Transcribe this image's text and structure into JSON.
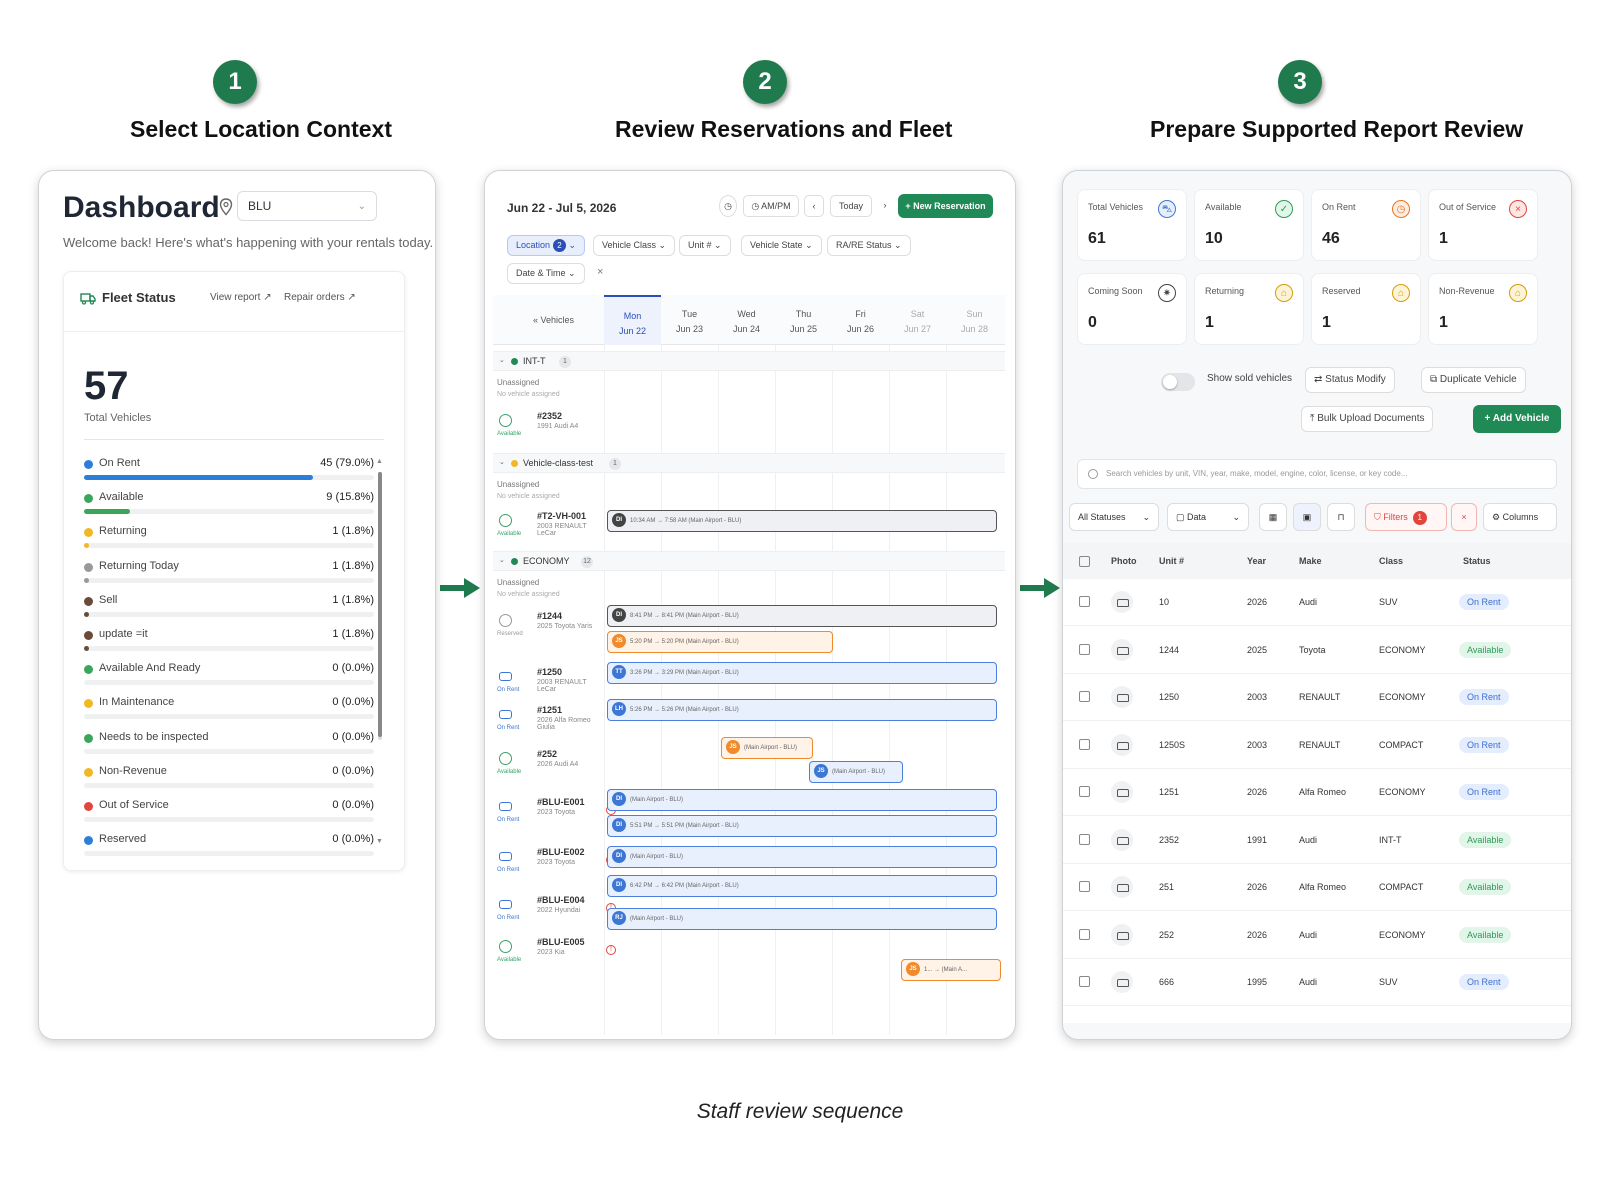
{
  "steps": [
    {
      "number": "1",
      "title": "Select Location Context"
    },
    {
      "number": "2",
      "title": "Review Reservations and Fleet"
    },
    {
      "number": "3",
      "title": "Prepare Supported Report Review"
    }
  ],
  "caption": "Staff review sequence",
  "panel1": {
    "title": "Dashboard",
    "location": "BLU",
    "welcome": "Welcome back! Here's what's happening with your rentals today.",
    "fleet_title": "Fleet Status",
    "view_report": "View report",
    "repair_orders": "Repair orders",
    "total": "57",
    "total_label": "Total Vehicles",
    "statuses": [
      {
        "name": "On Rent",
        "value": "45 (79.0%)",
        "color": "#2b7fd8",
        "fill": 0.79
      },
      {
        "name": "Available",
        "value": "9 (15.8%)",
        "color": "#3aa65a",
        "fill": 0.158
      },
      {
        "name": "Returning",
        "value": "1 (1.8%)",
        "color": "#f2b824",
        "fill": 0.018
      },
      {
        "name": "Returning Today",
        "value": "1 (1.8%)",
        "color": "#999999",
        "fill": 0.018
      },
      {
        "name": "Sell",
        "value": "1 (1.8%)",
        "color": "#6b4a3a",
        "fill": 0.018
      },
      {
        "name": "update =it",
        "value": "1 (1.8%)",
        "color": "#6b4a3a",
        "fill": 0.018
      },
      {
        "name": "Available And Ready",
        "value": "0 (0.0%)",
        "color": "#3aa65a",
        "fill": 0
      },
      {
        "name": "In Maintenance",
        "value": "0 (0.0%)",
        "color": "#f2b824",
        "fill": 0
      },
      {
        "name": "Needs to be inspected",
        "value": "0 (0.0%)",
        "color": "#3aa65a",
        "fill": 0
      },
      {
        "name": "Non-Revenue",
        "value": "0 (0.0%)",
        "color": "#f2b824",
        "fill": 0
      },
      {
        "name": "Out of Service",
        "value": "0 (0.0%)",
        "color": "#e0463b",
        "fill": 0
      },
      {
        "name": "Reserved",
        "value": "0 (0.0%)",
        "color": "#2b7fd8",
        "fill": 0
      }
    ]
  },
  "panel2": {
    "date_range": "Jun 22 - Jul 5, 2026",
    "ampm": "AM/PM",
    "today": "Today",
    "new_reservation": "New Reservation",
    "filters": {
      "location": "Location",
      "location_count": "2",
      "vehicle_class": "Vehicle Class",
      "unit": "Unit #",
      "vehicle_state": "Vehicle State",
      "rare_status": "RA/RE Status",
      "date_time": "Date & Time"
    },
    "vehicles_label": "« Vehicles",
    "days": [
      {
        "dow": "Mon",
        "date": "Jun 22"
      },
      {
        "dow": "Tue",
        "date": "Jun 23"
      },
      {
        "dow": "Wed",
        "date": "Jun 24"
      },
      {
        "dow": "Thu",
        "date": "Jun 25"
      },
      {
        "dow": "Fri",
        "date": "Jun 26"
      },
      {
        "dow": "Sat",
        "date": "Jun 27"
      },
      {
        "dow": "Sun",
        "date": "Jun 28"
      }
    ],
    "groups": [
      {
        "name": "INT-T",
        "count": "1"
      },
      {
        "name": "Vehicle-class-test",
        "count": "1"
      },
      {
        "name": "ECONOMY",
        "count": "12"
      }
    ],
    "unassigned": "Unassigned",
    "no_vehicle": "No vehicle assigned",
    "vehicles": [
      {
        "unit": "#2352",
        "desc": "1991 Audi A4",
        "status": "Available"
      },
      {
        "unit": "#T2-VH-001",
        "desc": "2003 RENAULT LeCar",
        "status": "Available"
      },
      {
        "unit": "#1244",
        "desc": "2025 Toyota Yaris",
        "status": "Reserved"
      },
      {
        "unit": "#1250",
        "desc": "2003 RENAULT LeCar",
        "status": "On Rent"
      },
      {
        "unit": "#1251",
        "desc": "2026 Alfa Romeo Giulia",
        "status": "On Rent"
      },
      {
        "unit": "#252",
        "desc": "2026 Audi A4",
        "status": "Available"
      },
      {
        "unit": "#BLU-E001",
        "desc": "2023 Toyota",
        "status": "On Rent"
      },
      {
        "unit": "#BLU-E002",
        "desc": "2023 Toyota",
        "status": "On Rent"
      },
      {
        "unit": "#BLU-E004",
        "desc": "2022 Hyundai",
        "status": "On Rent"
      },
      {
        "unit": "#BLU-E005",
        "desc": "2023 Kia",
        "status": "Available"
      }
    ],
    "bars": [
      {
        "initials": "DI",
        "text": "10:34 AM → 7:58 AM (Main Airport - BLU)"
      },
      {
        "initials": "DI",
        "text": "8:41 PM → 8:41 PM (Main Airport - BLU)"
      },
      {
        "initials": "JS",
        "text": "5:20 PM → 5:20 PM (Main Airport - BLU)"
      },
      {
        "initials": "TT",
        "text": "3:26 PM → 3:29 PM (Main Airport - BLU)"
      },
      {
        "initials": "LH",
        "text": "5:26 PM → 5:26 PM (Main Airport - BLU)"
      },
      {
        "initials": "JS",
        "text": "(Main Airport - BLU)"
      },
      {
        "initials": "JS",
        "text": "(Main Airport - BLU)"
      },
      {
        "initials": "DI",
        "text": "(Main Airport - BLU)"
      },
      {
        "initials": "DI",
        "text": "5:51 PM → 5:51 PM (Main Airport - BLU)"
      },
      {
        "initials": "DI",
        "text": "(Main Airport - BLU)"
      },
      {
        "initials": "DI",
        "text": "6:42 PM → 6:42 PM (Main Airport - BLU)"
      },
      {
        "initials": "RJ",
        "text": "(Main Airport - BLU)"
      },
      {
        "initials": "JS",
        "text": "1... → (Main A..."
      }
    ]
  },
  "panel3": {
    "cards": [
      {
        "label": "Total Vehicles",
        "value": "61",
        "icon": "car-icon",
        "icon_color": "#3c77d6",
        "icon_bg": "#e6eefc"
      },
      {
        "label": "Available",
        "value": "10",
        "icon": "check-circle-icon",
        "icon_color": "#2f9a5a",
        "icon_bg": "#e1f5e8"
      },
      {
        "label": "On Rent",
        "value": "46",
        "icon": "clock-icon",
        "icon_color": "#e8731f",
        "icon_bg": "#fdece0"
      },
      {
        "label": "Out of Service",
        "value": "1",
        "icon": "x-circle-icon",
        "icon_color": "#e0463b",
        "icon_bg": "#fde6e4"
      },
      {
        "label": "Coming Soon",
        "value": "0",
        "icon": "sparkle-icon",
        "icon_color": "#444444",
        "icon_bg": "#ffffff"
      },
      {
        "label": "Returning",
        "value": "1",
        "icon": "tag-icon",
        "icon_color": "#d49b0d",
        "icon_bg": "#fdf4d6"
      },
      {
        "label": "Reserved",
        "value": "1",
        "icon": "tag-icon",
        "icon_color": "#d49b0d",
        "icon_bg": "#fdf4d6"
      },
      {
        "label": "Non-Revenue",
        "value": "1",
        "icon": "tag-icon",
        "icon_color": "#d49b0d",
        "icon_bg": "#fdf4d6"
      }
    ],
    "show_sold": "Show sold vehicles",
    "status_modify": "Status Modify",
    "duplicate_vehicle": "Duplicate Vehicle",
    "bulk_upload": "Bulk Upload Documents",
    "add_vehicle": "Add Vehicle",
    "search_placeholder": "Search vehicles by unit, VIN, year, make, model, engine, color, license, or key code...",
    "all_statuses": "All Statuses",
    "data": "Data",
    "filters": "Filters",
    "filters_count": "1",
    "columns": "Columns",
    "headers": [
      "Photo",
      "Unit #",
      "Year",
      "Make",
      "Class",
      "Status"
    ],
    "rows": [
      {
        "unit": "10",
        "year": "2026",
        "make": "Audi",
        "class": "SUV",
        "status": "On Rent"
      },
      {
        "unit": "1244",
        "year": "2025",
        "make": "Toyota",
        "class": "ECONOMY",
        "status": "Available"
      },
      {
        "unit": "1250",
        "year": "2003",
        "make": "RENAULT",
        "class": "ECONOMY",
        "status": "On Rent"
      },
      {
        "unit": "1250S",
        "year": "2003",
        "make": "RENAULT",
        "class": "COMPACT",
        "status": "On Rent"
      },
      {
        "unit": "1251",
        "year": "2026",
        "make": "Alfa Romeo",
        "class": "ECONOMY",
        "status": "On Rent"
      },
      {
        "unit": "2352",
        "year": "1991",
        "make": "Audi",
        "class": "INT-T",
        "status": "Available"
      },
      {
        "unit": "251",
        "year": "2026",
        "make": "Alfa Romeo",
        "class": "COMPACT",
        "status": "Available"
      },
      {
        "unit": "252",
        "year": "2026",
        "make": "Audi",
        "class": "ECONOMY",
        "status": "Available"
      },
      {
        "unit": "666",
        "year": "1995",
        "make": "Audi",
        "class": "SUV",
        "status": "On Rent"
      }
    ]
  }
}
